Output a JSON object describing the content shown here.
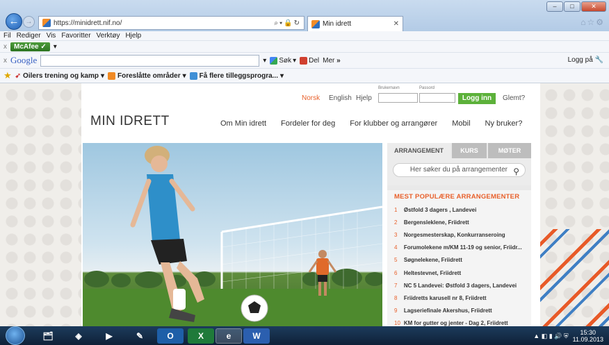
{
  "browser": {
    "url": "https://minidrett.nif.no/",
    "tab_title": "Min idrett",
    "menu": [
      "Fil",
      "Rediger",
      "Vis",
      "Favoritter",
      "Verktøy",
      "Hjelp"
    ],
    "mcafee_label": "McAfee",
    "google_label": "Google",
    "google_search_btn": "Søk",
    "google_share_btn": "Del",
    "google_more_btn": "Mer",
    "google_more_glyph": "»",
    "logg_pa": "Logg på",
    "favorites": [
      "Oilers trening og kamp",
      "Foreslåtte områder",
      "Få flere tilleggsprogra..."
    ]
  },
  "site": {
    "logo": "MIN IDRETT",
    "lang": {
      "norsk": "Norsk",
      "english": "English",
      "hjelp": "Hjelp"
    },
    "login": {
      "username_label": "Brukernavn",
      "password_label": "Passord",
      "button": "Logg inn",
      "forgot": "Glemt?"
    },
    "nav": [
      "Om Min idrett",
      "Fordeler for deg",
      "For klubber og arrangører",
      "Mobil",
      "Ny bruker?"
    ],
    "sidebar": {
      "tabs": [
        "ARRANGEMENT",
        "KURS",
        "MØTER"
      ],
      "search_placeholder": "Her søker du på arrangementer",
      "popular_title": "MEST POPULÆRE ARRANGEMENTER",
      "popular": [
        {
          "n": "1",
          "t": "Østfold 3 dagers , Landevei"
        },
        {
          "n": "2",
          "t": "Bergensleklene, Friidrett"
        },
        {
          "n": "3",
          "t": "Norgesmesterskap, Konkurranseroing"
        },
        {
          "n": "4",
          "t": "Forumolekene m/KM 11-19 og senior, Friidr..."
        },
        {
          "n": "5",
          "t": "Søgnelekene, Friidrett"
        },
        {
          "n": "6",
          "t": "Heltestevnet, Friidrett"
        },
        {
          "n": "7",
          "t": "NC 5 Landevei: Østfold 3 dagers, Landevei"
        },
        {
          "n": "8",
          "t": "Friidretts karusell nr 8, Friidrett"
        },
        {
          "n": "9",
          "t": "Lagseriefinale Akershus, Friidrett"
        },
        {
          "n": "10",
          "t": "KM for gutter og jenter - Dag 2, Friidrett"
        }
      ]
    }
  },
  "taskbar": {
    "time": "15:30",
    "date": "11.09.2013"
  }
}
